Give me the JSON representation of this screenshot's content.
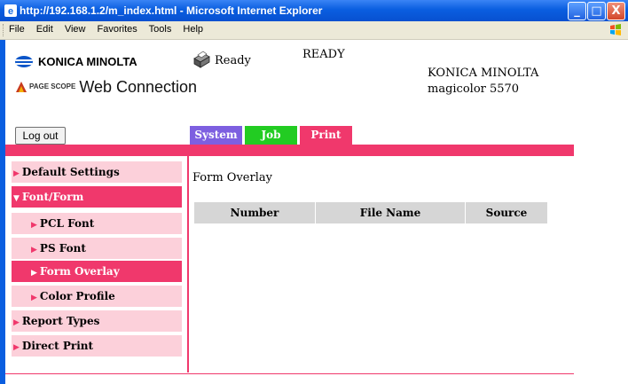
{
  "window": {
    "title": "http://192.168.1.2/m_index.html - Microsoft Internet Explorer",
    "min_glyph": "_",
    "max_glyph": "□",
    "close_glyph": "X"
  },
  "menu": [
    "File",
    "Edit",
    "View",
    "Favorites",
    "Tools",
    "Help"
  ],
  "brand": {
    "company": "KONICA MINOLTA",
    "pagescope_badge": "PAGE SCOPE",
    "product": "Web Connection"
  },
  "status": {
    "printer_state": "Ready",
    "panel_message": "READY"
  },
  "device": {
    "vendor": "KONICA MINOLTA",
    "model": "magicolor 5570"
  },
  "logout_label": "Log out",
  "tabs": [
    "System",
    "Job",
    "Print"
  ],
  "sidebar": {
    "items": [
      {
        "label": "Default Settings",
        "arrow": "▶"
      },
      {
        "label": "Font/Form",
        "arrow": "▼"
      },
      {
        "label": "PCL Font",
        "arrow": "▶"
      },
      {
        "label": "PS Font",
        "arrow": "▶"
      },
      {
        "label": "Form Overlay",
        "arrow": "▶"
      },
      {
        "label": "Color Profile",
        "arrow": "▶"
      },
      {
        "label": "Report Types",
        "arrow": "▶"
      },
      {
        "label": "Direct Print",
        "arrow": "▶"
      }
    ]
  },
  "content": {
    "title": "Form Overlay",
    "columns": [
      "Number",
      "File Name",
      "Source"
    ]
  },
  "colors": {
    "accent_pink": "#f0386c",
    "nav_pink_light": "#fcd0da",
    "tab_system": "#7d5fe0",
    "tab_job": "#22cc22",
    "titlebar_blue": "#0a5ee0"
  },
  "icons": {
    "titlebar": "ie-icon",
    "menubar": "windows-flag-icon",
    "status": "printer-icon",
    "brand": "konica-minolta-logo-icon"
  }
}
